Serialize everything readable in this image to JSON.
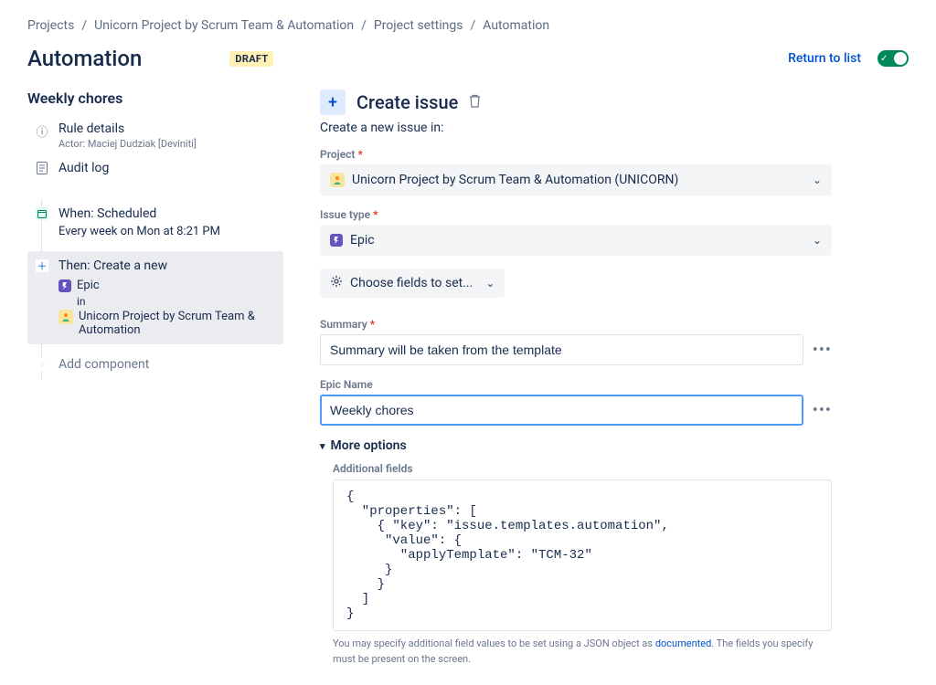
{
  "breadcrumbs": [
    "Projects",
    "Unicorn Project by Scrum Team & Automation",
    "Project settings",
    "Automation"
  ],
  "header": {
    "title": "Automation",
    "badge": "DRAFT",
    "return_label": "Return to list"
  },
  "sidebar": {
    "rule_name": "Weekly chores",
    "rule_details_label": "Rule details",
    "rule_details_sub": "Actor: Maciej Dudziak [Deviniti]",
    "audit_log_label": "Audit log",
    "when_label": "When: Scheduled",
    "when_sub": "Every week on Mon at 8:21 PM",
    "then_label": "Then: Create a new",
    "then_epic": "Epic",
    "then_in": "in",
    "then_project": "Unicorn Project by Scrum Team & Automation",
    "add_component": "Add component"
  },
  "main": {
    "title": "Create issue",
    "subtitle": "Create a new issue in:",
    "project_label": "Project",
    "project_value": "Unicorn Project by Scrum Team & Automation (UNICORN)",
    "issue_type_label": "Issue type",
    "issue_type_value": "Epic",
    "choose_fields": "Choose fields to set...",
    "summary_label": "Summary",
    "summary_value": "Summary will be taken from the template",
    "epic_name_label": "Epic Name",
    "epic_name_value": "Weekly chores",
    "more_options": "More options",
    "addl_fields_label": "Additional fields",
    "json_text": "{\n  \"properties\": [\n    { \"key\": \"issue.templates.automation\",\n     \"value\": {\n       \"applyTemplate\": \"TCM-32\"\n     }\n    }\n  ]\n}",
    "hint_pre": "You may specify additional field values to be set using a JSON object as ",
    "hint_link": "documented",
    "hint_post": ". The fields you specify must be present on the screen."
  }
}
